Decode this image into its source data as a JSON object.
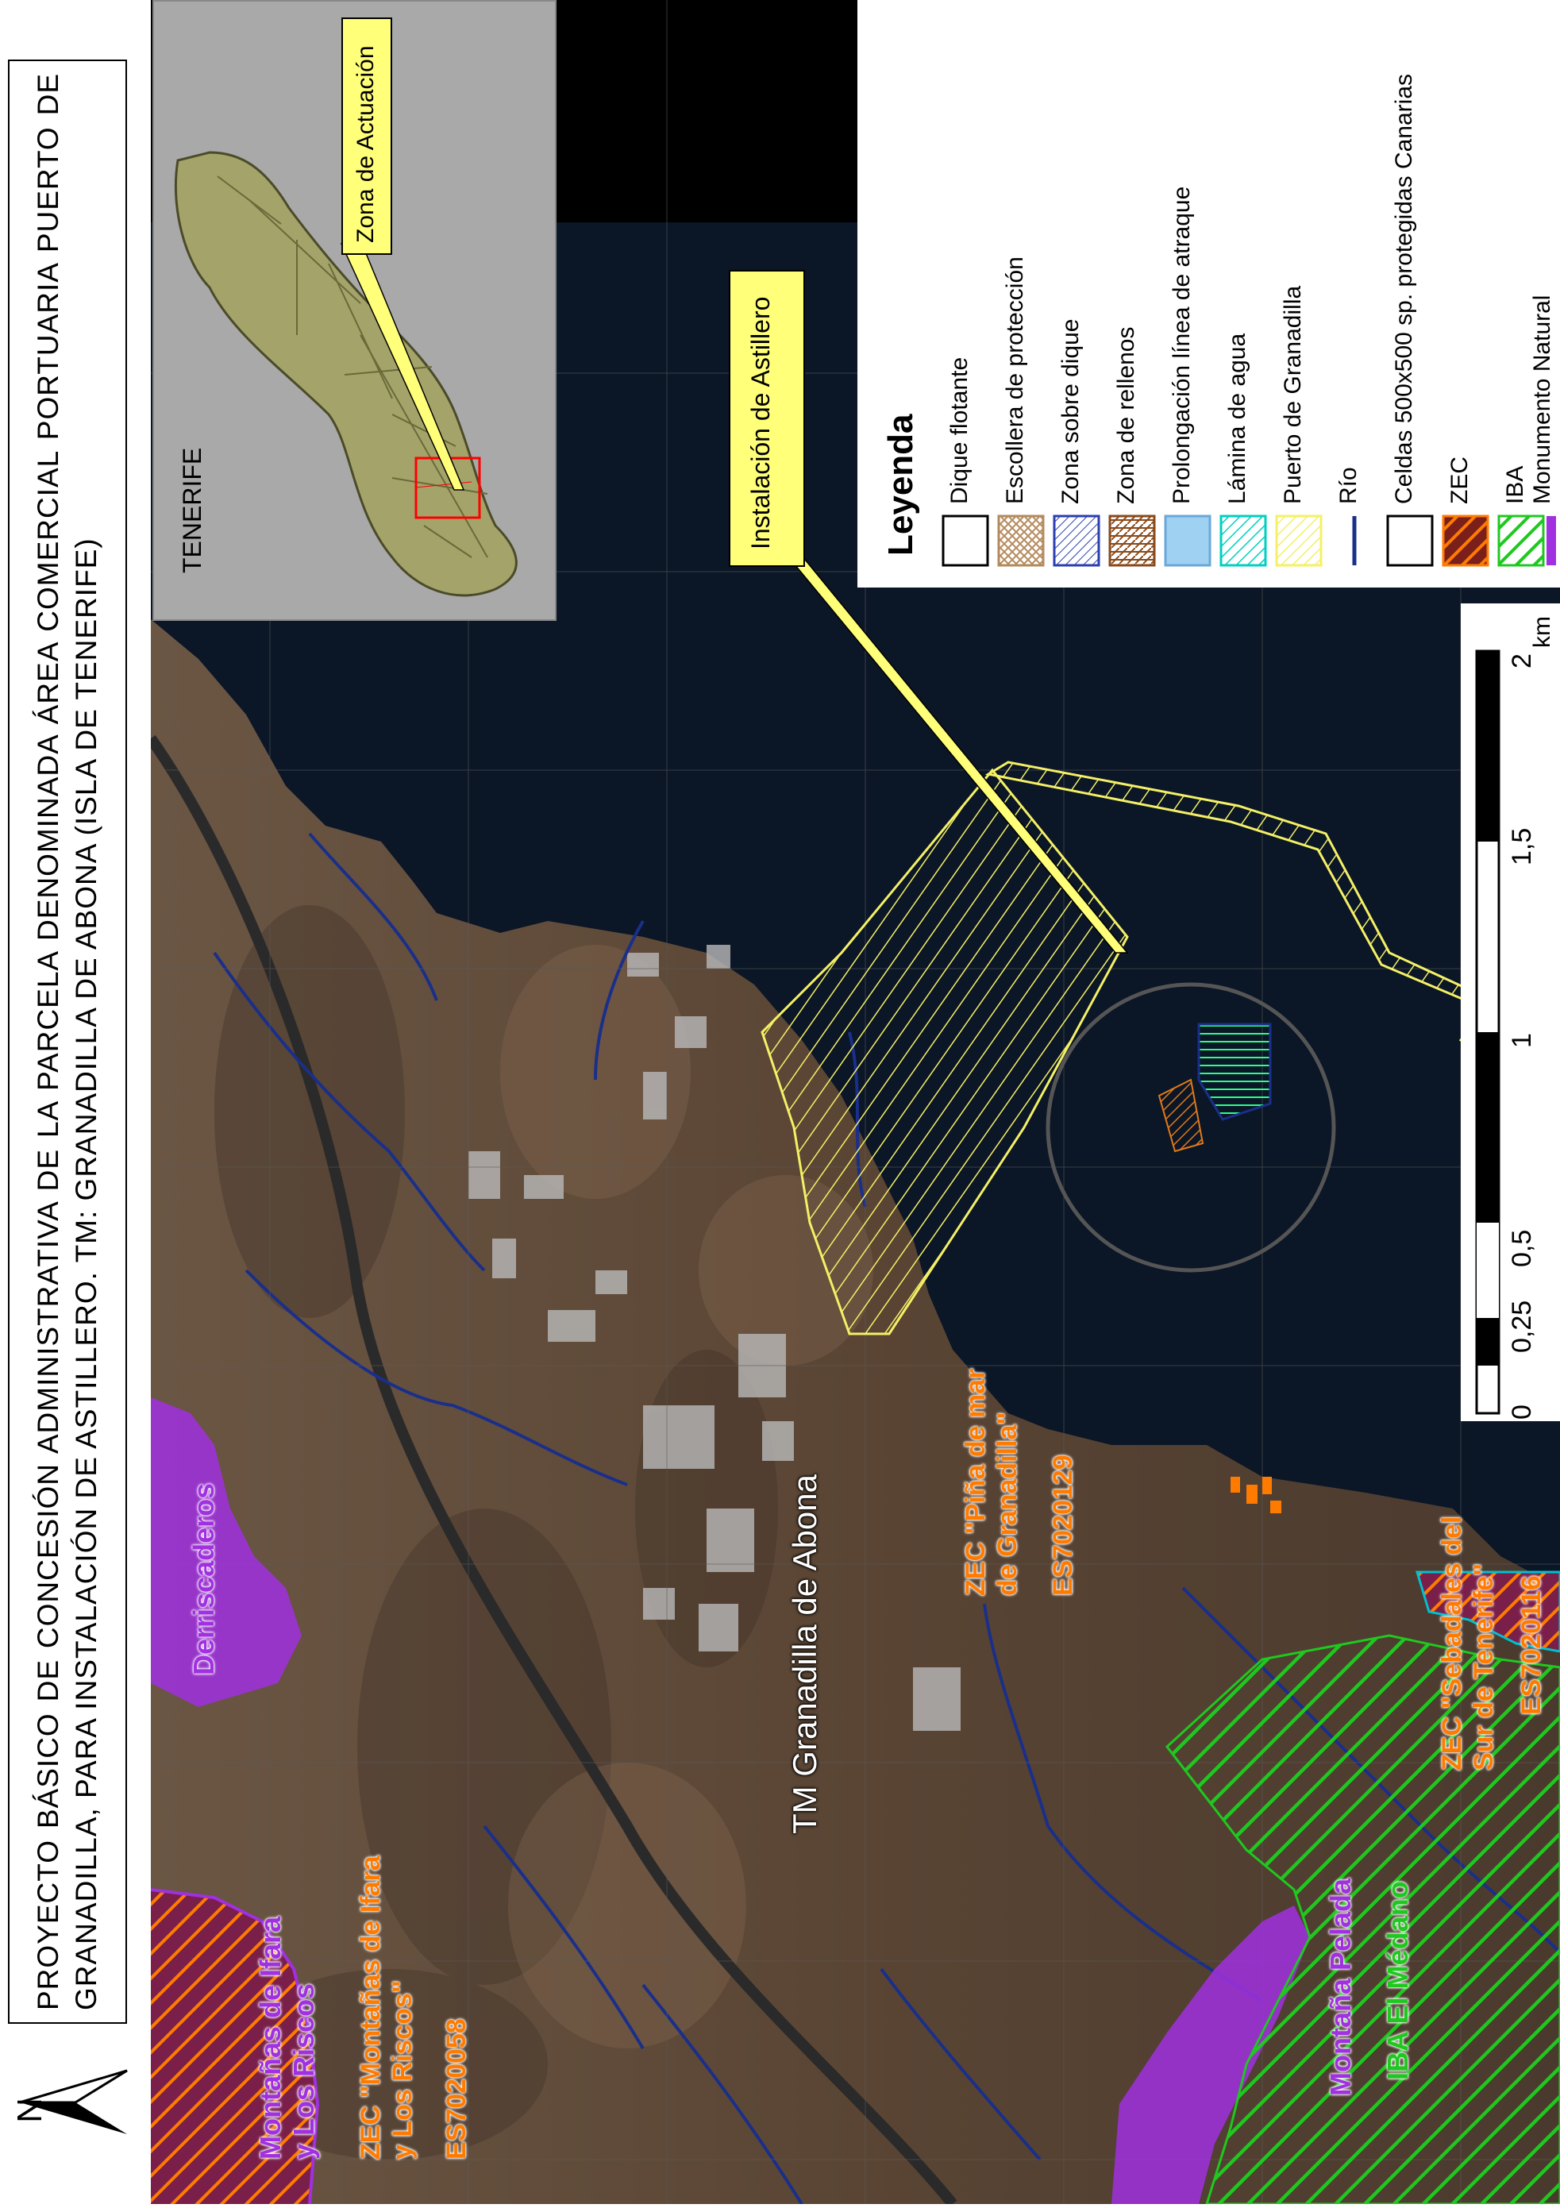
{
  "title": "PROYECTO BÁSICO DE CONCESIÓN ADMINISTRATIVA DE LA PARCELA DENOMINADA ÁREA COMERCIAL PORTUARIA PUERTO DE GRANADILLA, PARA INSTALACIÓN DE ASTILLERO. TM: GRANADILLA DE ABONA (ISLA DE TENERIFE)",
  "north_label": "N",
  "inset": {
    "island_name": "TENERIFE",
    "zone_label": "Zona de Actuación"
  },
  "legend": {
    "heading": "Leyenda",
    "items": [
      {
        "label": "Dique flotante",
        "swatch": "outline-black"
      },
      {
        "label": "Escollera de protección",
        "swatch": "hatch-tan"
      },
      {
        "label": "Zona sobre dique",
        "swatch": "hatch-blue"
      },
      {
        "label": "Zona de rellenos",
        "swatch": "hatch-brown"
      },
      {
        "label": "Prolongación línea de atraque",
        "swatch": "fill-lightblue"
      },
      {
        "label": "Lámina de agua",
        "swatch": "hatch-cyan"
      },
      {
        "label": "Puerto de Granadilla",
        "swatch": "hatch-yellow"
      },
      {
        "label": "Río",
        "swatch": "line-navy"
      },
      {
        "label": "Celdas 500x500 sp. protegidas Canarias",
        "swatch": "outline-black"
      },
      {
        "label": "ZEC",
        "swatch": "hatch-orange"
      },
      {
        "label": "IBA",
        "swatch": "hatch-green"
      },
      {
        "label": "Monumento Natural",
        "swatch": "fill-purple"
      }
    ]
  },
  "scale_bar": {
    "ticks": [
      "0",
      "0,25",
      "0,5",
      "1",
      "1,5",
      "2"
    ],
    "unit": "km"
  },
  "map_labels": {
    "astillero": "Instalación de Astillero",
    "municipality": "TM Granadilla de Abona",
    "zec_pina_1": "ZEC \"Piña de mar",
    "zec_pina_2": "de Granadilla\"",
    "zec_pina_code": "ES7020129",
    "zec_sebadales_1": "ZEC \"Sebadales del",
    "zec_sebadales_2": "Sur de Tenerife\"",
    "zec_sebadales_code": "ES7020116",
    "derriscaderos": "Derriscaderos",
    "ifara_mn_1": "Montañas de Ifara",
    "ifara_mn_2": "y Los Riscos",
    "zec_ifara_1": "ZEC \"Montañas de Ifara",
    "zec_ifara_2": "y Los Riscos\"",
    "zec_ifara_code": "ES7020058",
    "montana_pelada": "Montaña Pelada",
    "iba_medano": "IBA El Médano"
  },
  "colors": {
    "terrain": "#5e4a38",
    "sea": "#0d1a2a",
    "port_yellow": "#f4f066",
    "zec_orange": "#ff7b00",
    "iba_green": "#1fc81f",
    "monumento_purple": "#a030e0",
    "river_navy": "#1a2f8a",
    "inset_island": "#a3a36a"
  }
}
